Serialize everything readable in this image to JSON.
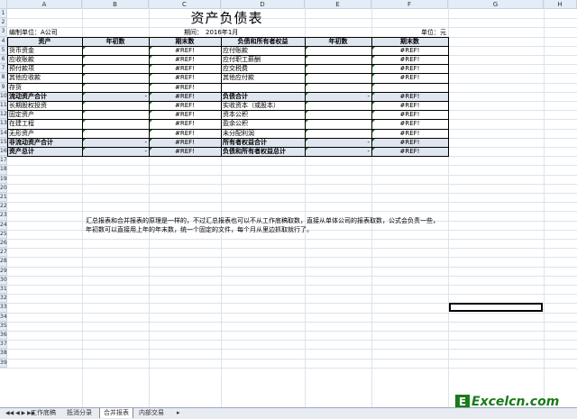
{
  "columns": [
    "A",
    "B",
    "C",
    "D",
    "E",
    "F",
    "G",
    "H"
  ],
  "rows": [
    "1",
    "2",
    "3",
    "4",
    "5",
    "6",
    "7",
    "8",
    "9",
    "10",
    "11",
    "12",
    "13",
    "14",
    "15",
    "16",
    "17",
    "18",
    "19",
    "20",
    "21",
    "22",
    "23",
    "24",
    "25",
    "26",
    "27",
    "28",
    "29",
    "30",
    "31",
    "32",
    "33",
    "34",
    "35",
    "36",
    "37",
    "38",
    "39"
  ],
  "title": "资产负债表",
  "subheader": {
    "unit_left": "编制单位：A公司",
    "period_label": "期间：",
    "period_value": "2016年1月",
    "unit_right": "单位：元"
  },
  "table": {
    "headers": [
      "资产",
      "年初数",
      "期末数",
      "负债和所有者权益",
      "年初数",
      "期末数"
    ],
    "rows": [
      [
        "货币资金",
        "",
        "#REF!",
        "应付账款",
        "",
        "#REF!"
      ],
      [
        "应收账款",
        "",
        "#REF!",
        "应付职工薪酬",
        "",
        "#REF!"
      ],
      [
        "预付款项",
        "",
        "#REF!",
        "应交税费",
        "",
        "#REF!"
      ],
      [
        "其他应收款",
        "",
        "#REF!",
        "其他应付款",
        "",
        "#REF!"
      ],
      [
        "存货",
        "",
        "#REF!",
        "",
        "",
        ""
      ],
      [
        "流动资产合计",
        "-",
        "#REF!",
        "负债合计",
        "-",
        "#REF!"
      ],
      [
        "长期股权投资",
        "",
        "#REF!",
        "实收资本（或股本）",
        "",
        "#REF!"
      ],
      [
        "固定资产",
        "",
        "#REF!",
        "资本公积",
        "",
        "#REF!"
      ],
      [
        "在建工程",
        "",
        "#REF!",
        "盈余公积",
        "",
        "#REF!"
      ],
      [
        "无形资产",
        "",
        "#REF!",
        "未分配利润",
        "",
        "#REF!"
      ],
      [
        "非流动资产合计",
        "-",
        "#REF!",
        "所有者权益合计",
        "-",
        "#REF!"
      ],
      [
        "资产总计",
        "-",
        "#REF!",
        "负债和所有者权益总计",
        "-",
        "#REF!"
      ]
    ]
  },
  "note_line1": "汇总报表和合并报表的原理是一样的，不过汇总报表也可以不从工作底稿取数，直接从单体公司的报表取数，公式会负责一些，",
  "note_line2": "年初数可以直接用上年的年末数，统一个固定的文件，每个月从里边抓取就行了。",
  "tabs": [
    "工作底稿",
    "抵消分录",
    "合并报表",
    "内部交易"
  ],
  "active_tab": "合并报表",
  "logo": {
    "letter": "E",
    "text": "Excelcn.com"
  }
}
